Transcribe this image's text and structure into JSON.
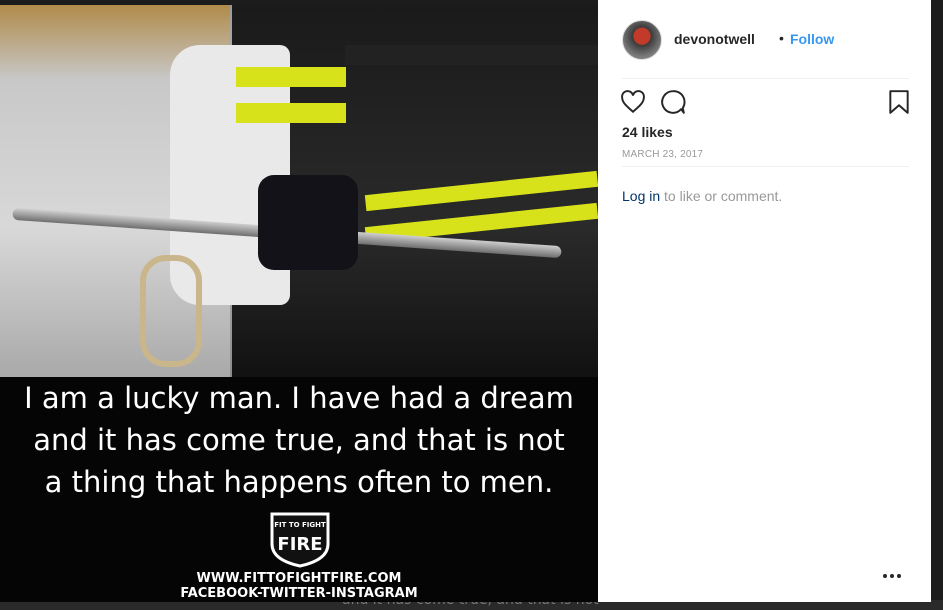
{
  "post": {
    "quote_lines": [
      "I am a lucky man. I have had a dream",
      "and it has come true, and that is not",
      "a thing that happens often to men."
    ],
    "logo": {
      "top_text": "FIT TO FIGHT",
      "main_text": "FIRE"
    },
    "website": "WWW.FITTOFIGHTFIRE.COM",
    "social": "FACEBOOK-TWITTER-INSTAGRAM"
  },
  "panel": {
    "username": "devonotwell",
    "separator": "•",
    "follow_label": "Follow",
    "likes": "24 likes",
    "date": "MARCH 23, 2017",
    "login_link": "Log in",
    "login_rest": " to like or comment.",
    "more_label": "..."
  },
  "backdrop": {
    "text": "and it has come true, and that is not"
  },
  "icons": {
    "like": "heart-icon",
    "comment": "comment-icon",
    "save": "bookmark-icon",
    "more": "more-options-icon"
  },
  "colors": {
    "accent": "#3897f0",
    "link": "#003569",
    "text": "#262626",
    "muted": "#999999"
  }
}
